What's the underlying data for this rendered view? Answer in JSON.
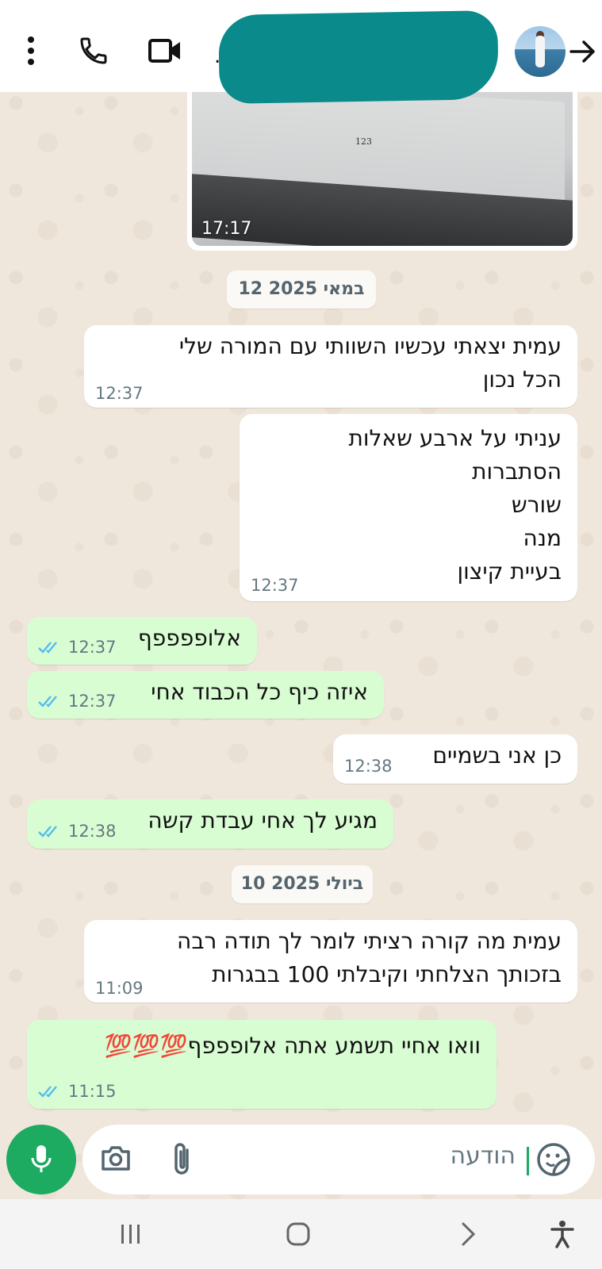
{
  "header": {
    "contact_name_suffix": "...",
    "back_icon": "arrow-right-icon",
    "icons": [
      "more-vert-icon",
      "phone-icon",
      "video-icon"
    ]
  },
  "image_message": {
    "page_number": "123",
    "time": "17:17"
  },
  "date_chips": [
    {
      "label": "12 במאי 2025"
    },
    {
      "label": "10 ביולי 2025"
    }
  ],
  "messages": [
    {
      "direction": "in",
      "text": "עמית יצאתי עכשיו השוותי עם המורה שלי\nהכל נכון",
      "time": "12:37"
    },
    {
      "direction": "in",
      "text": "עניתי על ארבע שאלות\nהסתברות\nשורש\nמנה\nבעיית קיצון",
      "time": "12:37"
    },
    {
      "direction": "out",
      "text": "אלופפפפף",
      "time": "12:37",
      "status": "read"
    },
    {
      "direction": "out",
      "text": "איזה כיף כל הכבוד אחי",
      "time": "12:37",
      "status": "read"
    },
    {
      "direction": "in",
      "text": "כן אני בשמיים",
      "time": "12:38"
    },
    {
      "direction": "out",
      "text": "מגיע לך אחי עבדת קשה",
      "time": "12:38",
      "status": "read"
    },
    {
      "direction": "in",
      "text": "עמית מה קורה רציתי לומר לך תודה רבה\nבזכותך הצלחתי וקיבלתי 100 בבגרות",
      "time": "11:09"
    },
    {
      "direction": "out",
      "text": "וואו אחיי תשמע אתה אלופפפף💯💯💯",
      "time": "11:15",
      "status": "read"
    }
  ],
  "composer": {
    "placeholder": "הודעה",
    "icons": [
      "mic-icon",
      "camera-icon",
      "attach-icon",
      "sticker-icon"
    ]
  },
  "nav": {
    "icons": [
      "recents-icon",
      "home-icon",
      "back-icon",
      "accessibility-icon"
    ]
  },
  "colors": {
    "accent": "#1daa61",
    "outgoing_bubble": "#d9fdd3",
    "incoming_bubble": "#ffffff",
    "read_ticks": "#53bdeb",
    "redaction": "#0a8a8a"
  }
}
